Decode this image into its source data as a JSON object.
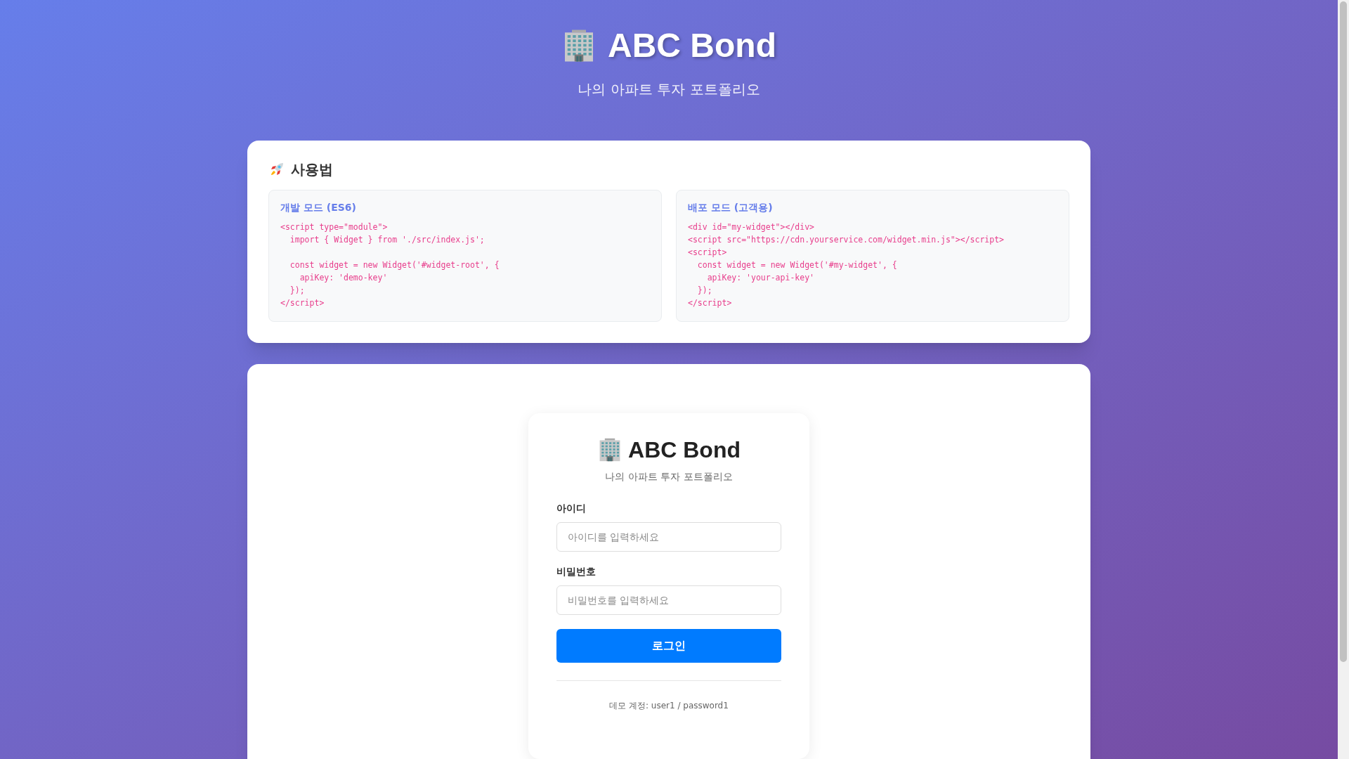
{
  "header": {
    "title": "ABC Bond",
    "subtitle": "나의 아파트 투자 포트폴리오"
  },
  "usage": {
    "title": "사용법",
    "blocks": [
      {
        "title": "개발 모드 (ES6)",
        "code": "<script type=\"module\">\n  import { Widget } from './src/index.js';\n\n  const widget = new Widget('#widget-root', {\n    apiKey: 'demo-key'\n  });\n</script>"
      },
      {
        "title": "배포 모드 (고객용)",
        "code": "<div id=\"my-widget\"></div>\n<script src=\"https://cdn.yourservice.com/widget.min.js\"></script>\n<script>\n  const widget = new Widget('#my-widget', {\n    apiKey: 'your-api-key'\n  });\n</script>"
      }
    ]
  },
  "login": {
    "title": "ABC Bond",
    "subtitle": "나의 아파트 투자 포트폴리오",
    "fields": [
      {
        "label": "아이디",
        "placeholder": "아이디를 입력하세요"
      },
      {
        "label": "비밀번호",
        "placeholder": "비밀번호를 입력하세요"
      }
    ],
    "button": "로그인",
    "demo_note": "데모 계정: user1 / password1"
  }
}
